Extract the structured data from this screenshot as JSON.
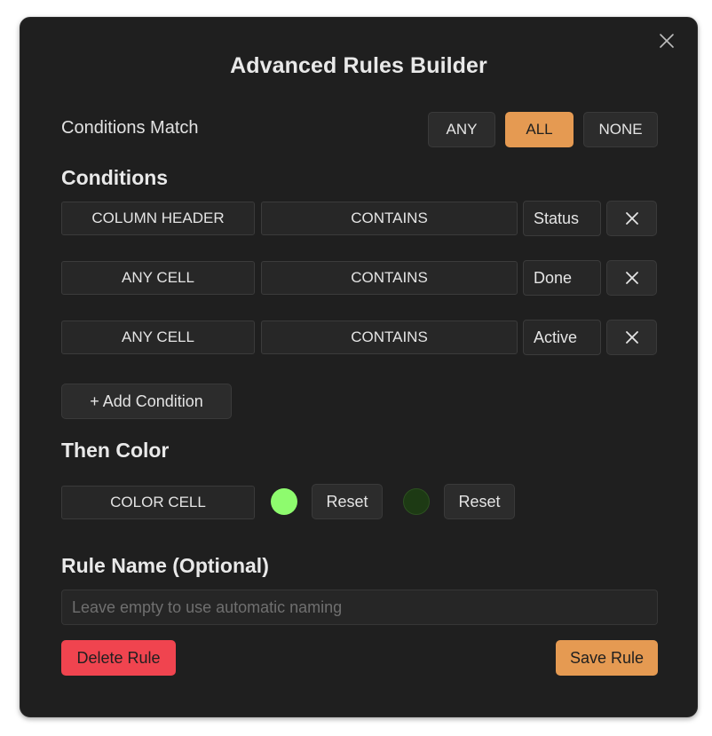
{
  "dialog": {
    "title": "Advanced Rules Builder",
    "close_icon": "close-icon"
  },
  "match": {
    "label": "Conditions Match",
    "options": [
      "ANY",
      "ALL",
      "NONE"
    ],
    "selected": "ALL"
  },
  "conditions": {
    "heading": "Conditions",
    "rows": [
      {
        "target": "COLUMN HEADER",
        "operator": "CONTAINS",
        "value": "Status",
        "remove_icon": "close-icon"
      },
      {
        "target": "ANY CELL",
        "operator": "CONTAINS",
        "value": "Done",
        "remove_icon": "close-icon"
      },
      {
        "target": "ANY CELL",
        "operator": "CONTAINS",
        "value": "Active",
        "remove_icon": "close-icon"
      }
    ],
    "add_label": "+ Add Condition"
  },
  "then_color": {
    "heading": "Then Color",
    "action": "COLOR CELL",
    "primary_color": "#8efb6e",
    "primary_reset": "Reset",
    "secondary_color": "#1d3a14",
    "secondary_reset": "Reset"
  },
  "rule_name": {
    "heading": "Rule Name (Optional)",
    "value": "",
    "placeholder": "Leave empty to use automatic naming"
  },
  "footer": {
    "delete_label": "Delete Rule",
    "save_label": "Save Rule"
  },
  "colors": {
    "accent": "#e59a52",
    "danger": "#f0444f",
    "panel": "#1f1f1f"
  }
}
